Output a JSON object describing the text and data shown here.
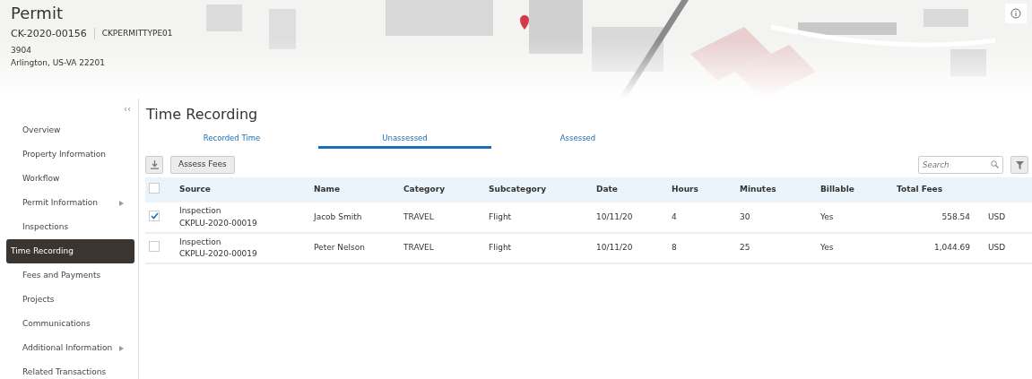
{
  "header": {
    "title": "Permit",
    "permit_number": "CK-2020-00156",
    "permit_type": "CKPERMITTYPE01",
    "address_lines": [
      "3904",
      "Arlington, US-VA 22201"
    ]
  },
  "sidebar": {
    "collapse": "‹‹",
    "items": [
      {
        "label": "Overview",
        "kind": "link",
        "selected": false
      },
      {
        "label": "Property Information",
        "kind": "link",
        "selected": false
      },
      {
        "label": "Workflow",
        "kind": "link",
        "selected": false
      },
      {
        "label": "Permit Information",
        "kind": "submenu",
        "selected": false
      },
      {
        "label": "Inspections",
        "kind": "link",
        "selected": false
      },
      {
        "label": "Time Recording",
        "kind": "link",
        "selected": true
      },
      {
        "label": "Fees and Payments",
        "kind": "link",
        "selected": false
      },
      {
        "label": "Projects",
        "kind": "link",
        "selected": false
      },
      {
        "label": "Communications",
        "kind": "link",
        "selected": false
      },
      {
        "label": "Additional Information",
        "kind": "submenu",
        "selected": false
      },
      {
        "label": "Related Transactions",
        "kind": "link",
        "selected": false
      }
    ]
  },
  "page_title": "Time Recording",
  "tabs": [
    {
      "label": "Recorded Time",
      "selected": false
    },
    {
      "label": "Unassessed",
      "selected": true
    },
    {
      "label": "Assessed",
      "selected": false
    }
  ],
  "toolbar": {
    "action_button": "Assess Fees",
    "search": {
      "placeholder": "Search"
    }
  },
  "table": {
    "select_all_checked": false,
    "columns": [
      "Source",
      "Name",
      "Category",
      "Subcategory",
      "Date",
      "Hours",
      "Minutes",
      "Billable",
      "Total Fees"
    ],
    "rows": [
      {
        "checked": true,
        "source": [
          "Inspection",
          "CKPLU-2020-00019"
        ],
        "name": "Jacob Smith",
        "category": "TRAVEL",
        "subcategory": "Flight",
        "date": "10/11/20",
        "hours": "4",
        "minutes": "30",
        "billable": "Yes",
        "total_fees": "558.54",
        "currency": "USD"
      },
      {
        "checked": false,
        "source": [
          "Inspection",
          "CKPLU-2020-00019"
        ],
        "name": "Peter Nelson",
        "category": "TRAVEL",
        "subcategory": "Flight",
        "date": "10/11/20",
        "hours": "8",
        "minutes": "25",
        "billable": "Yes",
        "total_fees": "1,044.69",
        "currency": "USD"
      }
    ]
  }
}
